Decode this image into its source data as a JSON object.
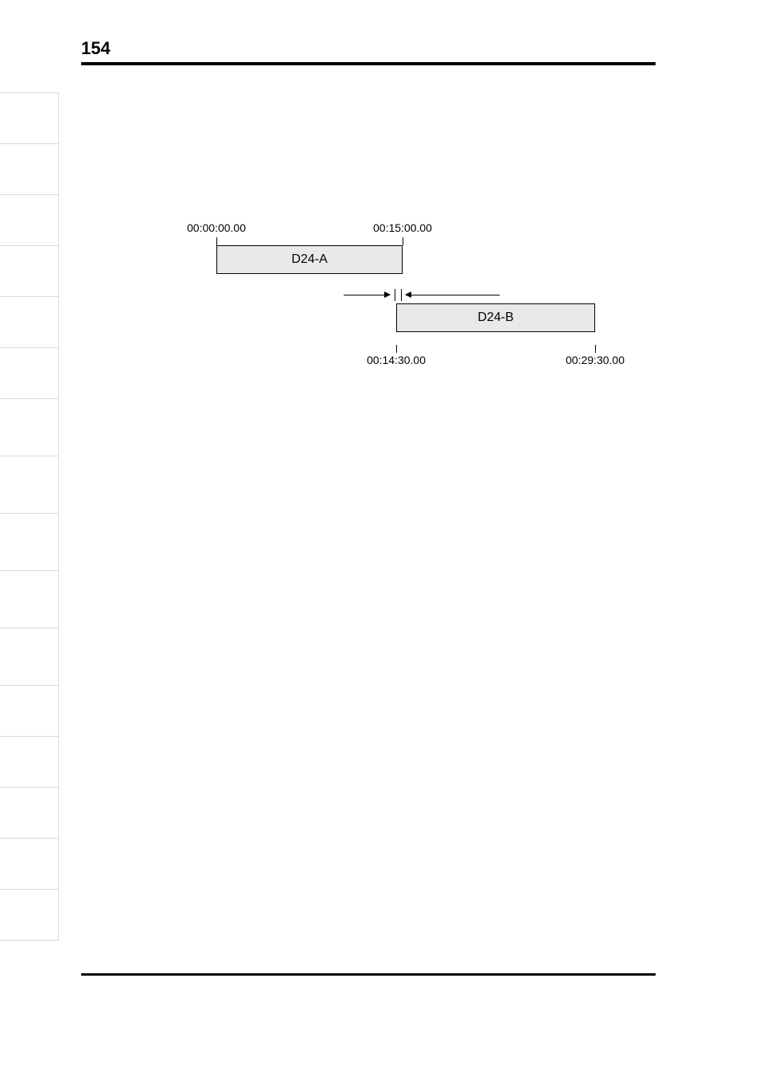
{
  "page_number": "154",
  "diagram": {
    "top_left_tc": "00:00:00.00",
    "top_right_tc": "00:15:00.00",
    "bottom_left_tc": "00:14:30.00",
    "bottom_right_tc": "00:29:30.00",
    "box_a": "D24-A",
    "box_b": "D24-B"
  }
}
